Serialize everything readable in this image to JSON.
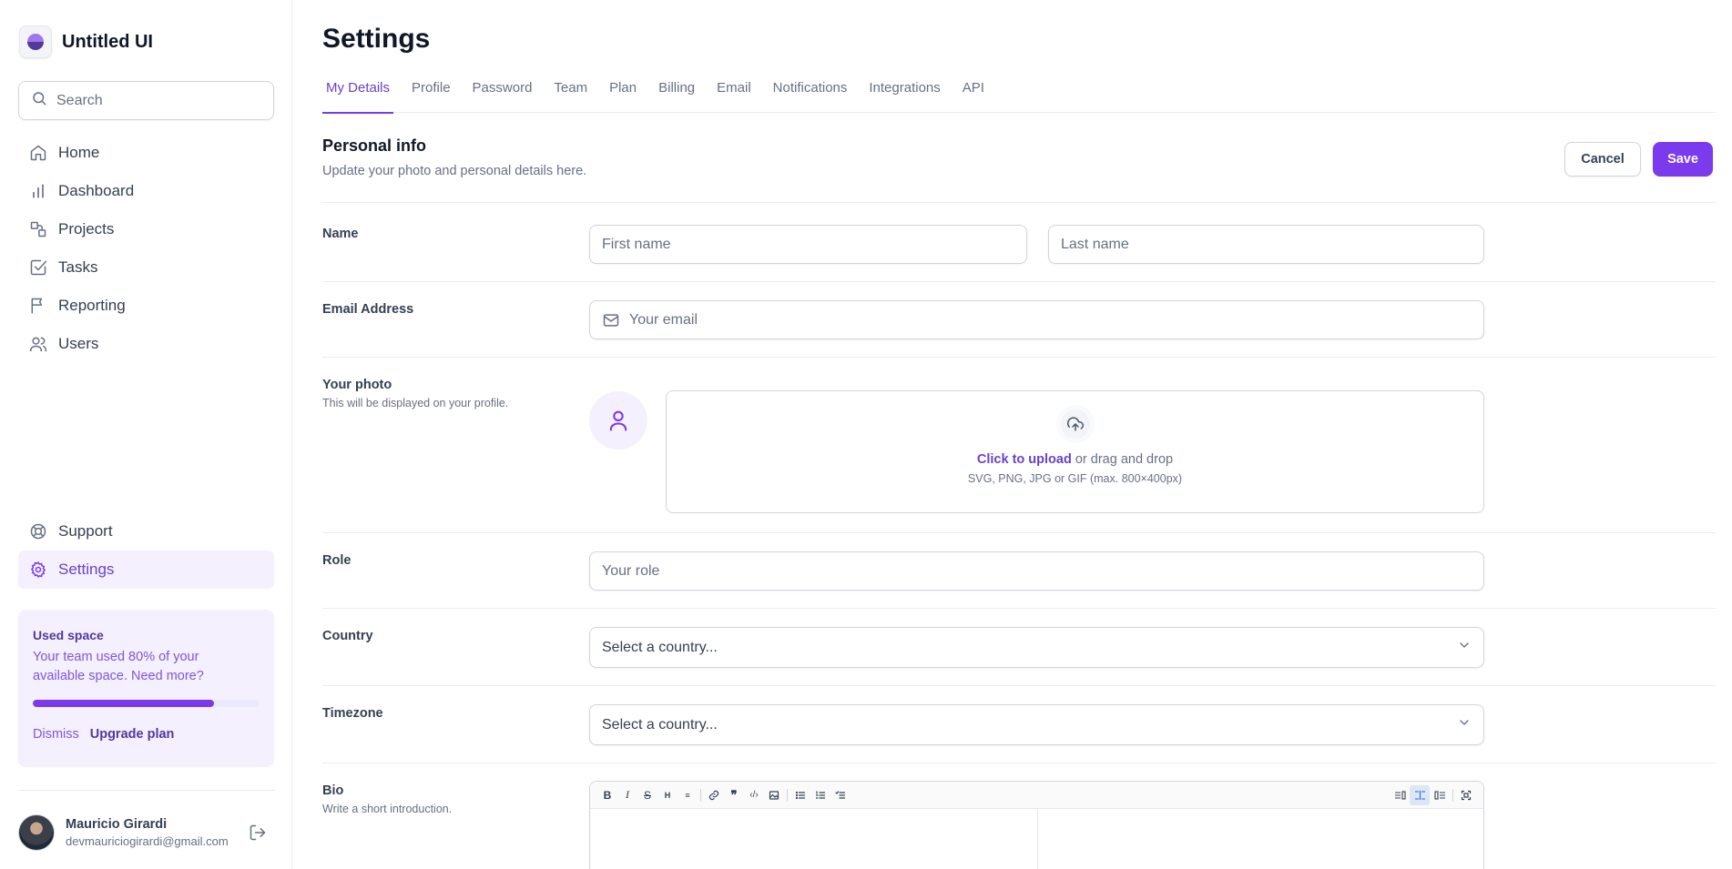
{
  "brand": {
    "name": "Untitled UI"
  },
  "search": {
    "placeholder": "Search"
  },
  "nav": {
    "items": [
      {
        "label": "Home",
        "icon": "home-icon"
      },
      {
        "label": "Dashboard",
        "icon": "bar-chart-icon"
      },
      {
        "label": "Projects",
        "icon": "layers-icon"
      },
      {
        "label": "Tasks",
        "icon": "check-square-icon"
      },
      {
        "label": "Reporting",
        "icon": "flag-icon"
      },
      {
        "label": "Users",
        "icon": "users-icon"
      }
    ],
    "bottom": [
      {
        "label": "Support",
        "icon": "life-buoy-icon"
      },
      {
        "label": "Settings",
        "icon": "gear-icon",
        "active": true
      }
    ]
  },
  "usage": {
    "title": "Used space",
    "text": "Your team used 80% of your available space. Need more?",
    "percent": 80,
    "dismiss": "Dismiss",
    "upgrade": "Upgrade plan"
  },
  "user": {
    "name": "Mauricio Girardi",
    "email": "devmauriciogirardi@gmail.com"
  },
  "page": {
    "title": "Settings",
    "tabs": [
      "My Details",
      "Profile",
      "Password",
      "Team",
      "Plan",
      "Billing",
      "Email",
      "Notifications",
      "Integrations",
      "API"
    ],
    "active_tab": "My Details"
  },
  "section": {
    "title": "Personal info",
    "subtitle": "Update your photo and personal details here.",
    "cancel": "Cancel",
    "save": "Save"
  },
  "form": {
    "name": {
      "label": "Name",
      "first_placeholder": "First name",
      "last_placeholder": "Last name"
    },
    "email": {
      "label": "Email Address",
      "placeholder": "Your email"
    },
    "photo": {
      "label": "Your photo",
      "hint": "This will be displayed on your profile.",
      "upload_link": "Click to upload",
      "upload_rest": " or drag and drop",
      "upload_hint": "SVG, PNG, JPG or GIF (max. 800×400px)"
    },
    "role": {
      "label": "Role",
      "placeholder": "Your role"
    },
    "country": {
      "label": "Country",
      "value": "Select a country..."
    },
    "timezone": {
      "label": "Timezone",
      "value": "Select a country..."
    },
    "bio": {
      "label": "Bio",
      "hint": "Write a short introduction."
    }
  },
  "colors": {
    "accent": "#7c3aed",
    "accent_text": "#6941c6",
    "active_bg": "#f4f0fd"
  }
}
